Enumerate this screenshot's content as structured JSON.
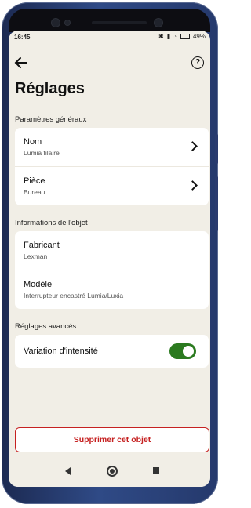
{
  "status": {
    "time": "16:45",
    "battery": "49%"
  },
  "header": {
    "title": "Réglages"
  },
  "sections": {
    "general": {
      "heading": "Paramètres généraux",
      "rows": [
        {
          "label": "Nom",
          "value": "Lumia filaire"
        },
        {
          "label": "Pièce",
          "value": "Bureau"
        }
      ]
    },
    "info": {
      "heading": "Informations de l'objet",
      "rows": [
        {
          "label": "Fabricant",
          "value": "Lexman"
        },
        {
          "label": "Modèle",
          "value": "Interrupteur encastré Lumia/Luxia"
        }
      ]
    },
    "advanced": {
      "heading": "Réglages avancés",
      "dimming_label": "Variation d'intensité",
      "dimming_on": true
    }
  },
  "actions": {
    "delete_label": "Supprimer cet objet"
  },
  "colors": {
    "accent_green": "#2b7a1f",
    "danger": "#c62121",
    "background": "#f1eee6"
  }
}
